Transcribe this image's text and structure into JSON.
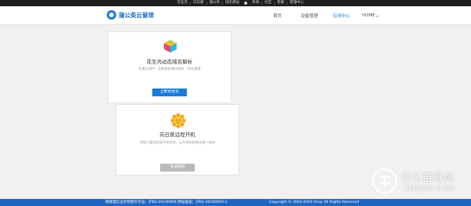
{
  "topbar": {
    "links": [
      "花生壳",
      "向日葵",
      "蒲公英",
      "域名建站",
      "商城",
      "社区",
      "客服",
      "管理中心"
    ]
  },
  "header": {
    "logo_text": "蒲公英云管理",
    "nav": {
      "home": "首页",
      "device": "设备管理",
      "apps": "应用中心",
      "home_en": "HOME",
      "caret": "▾"
    },
    "active_color": "#1a7ad9"
  },
  "cards": [
    {
      "title": "花生壳动态域名解析",
      "desc": "无需公网IP、无需路由端口映射、即在掌握",
      "button": "立即初始化",
      "button_color": "#1a7ad9",
      "icon": "colorful-cube-icon"
    },
    {
      "title": "向日葵远程开机",
      "desc": "添加九楼的远程开机体验，让开机和控制无缝一体化",
      "button": "敬请期待",
      "button_color": "#b9b9b9",
      "icon": "sunflower-icon"
    }
  ],
  "footer": {
    "license": "增值电信业务经营许可证：沪B2-20100004   网站备案：沪B2-20100004-1",
    "copyright": "Copyright © 2002-2016 Oray. All Rights Reserved"
  },
  "watermark": {
    "text_cn": "什么值得买",
    "text_en": "SMZDM.COM"
  }
}
